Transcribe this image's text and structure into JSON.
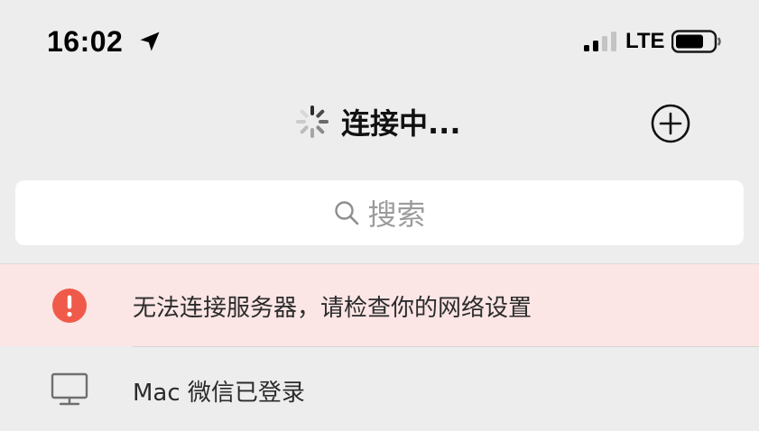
{
  "status_bar": {
    "time": "16:02",
    "location_icon": "location-arrow-icon",
    "signal_icon": "cellular-signal-icon",
    "network": "LTE",
    "battery_icon": "battery-icon"
  },
  "nav": {
    "title": "连接中...",
    "spinner_icon": "loading-spinner-icon",
    "add_icon": "plus-circle-icon"
  },
  "search": {
    "icon": "search-icon",
    "placeholder": "搜索"
  },
  "error_banner": {
    "icon": "exclamation-circle-icon",
    "message": "无法连接服务器，请检查你的网络设置",
    "color": "#f05a4a",
    "background": "#fbe5e5"
  },
  "mac_login": {
    "icon": "monitor-icon",
    "label": "Mac 微信已登录"
  }
}
